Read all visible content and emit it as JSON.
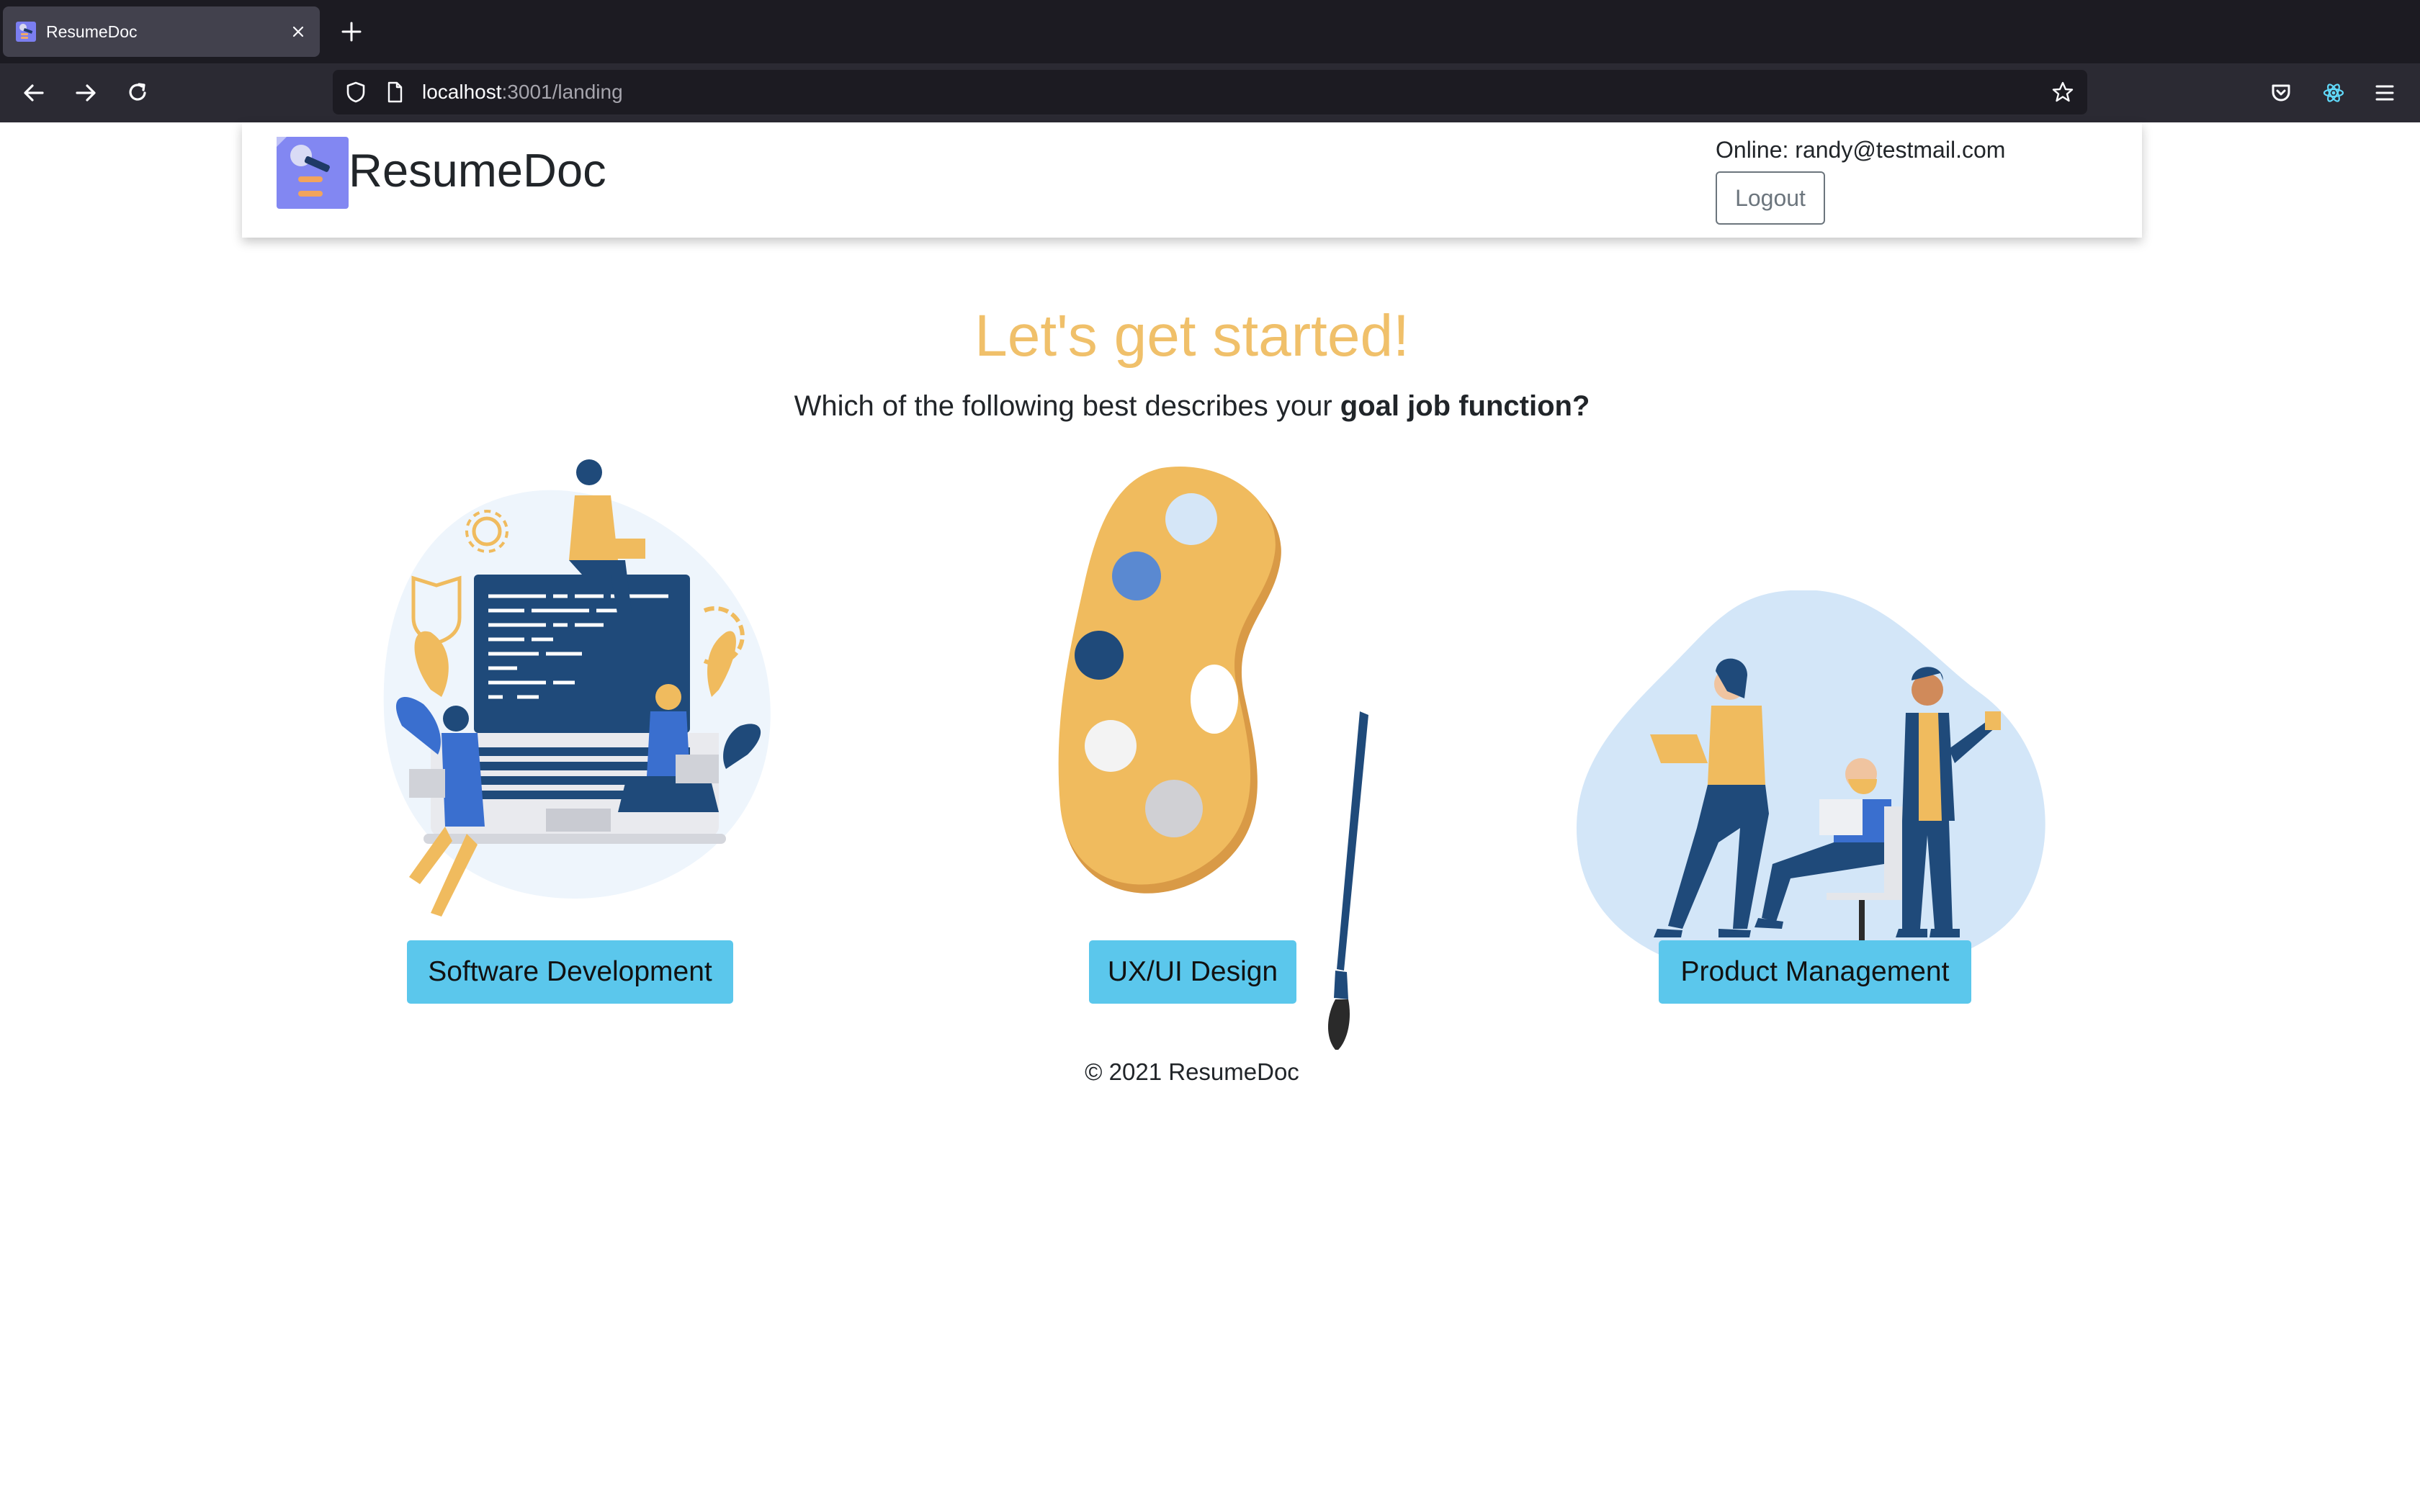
{
  "browser": {
    "tab_title": "ResumeDoc",
    "url_host": "localhost",
    "url_path": ":3001/landing"
  },
  "header": {
    "brand": "ResumeDoc",
    "online_status": "Online: randy@testmail.com",
    "logout_label": "Logout"
  },
  "main": {
    "headline": "Let's get started!",
    "subtitle_prefix": "Which of the following best describes your ",
    "subtitle_bold": "goal job function?",
    "options": [
      {
        "label": "Software Development",
        "icon": "software-development-illustration"
      },
      {
        "label": "UX/UI Design",
        "icon": "paint-palette-illustration"
      },
      {
        "label": "Product Management",
        "icon": "product-team-illustration"
      }
    ]
  },
  "footer": {
    "copyright": "© 2021 ResumeDoc"
  },
  "colors": {
    "accent_headline": "#f0c06a",
    "button_bg": "#5bc7ec",
    "navy": "#1f4a7a",
    "gold": "#f0bb5e"
  }
}
